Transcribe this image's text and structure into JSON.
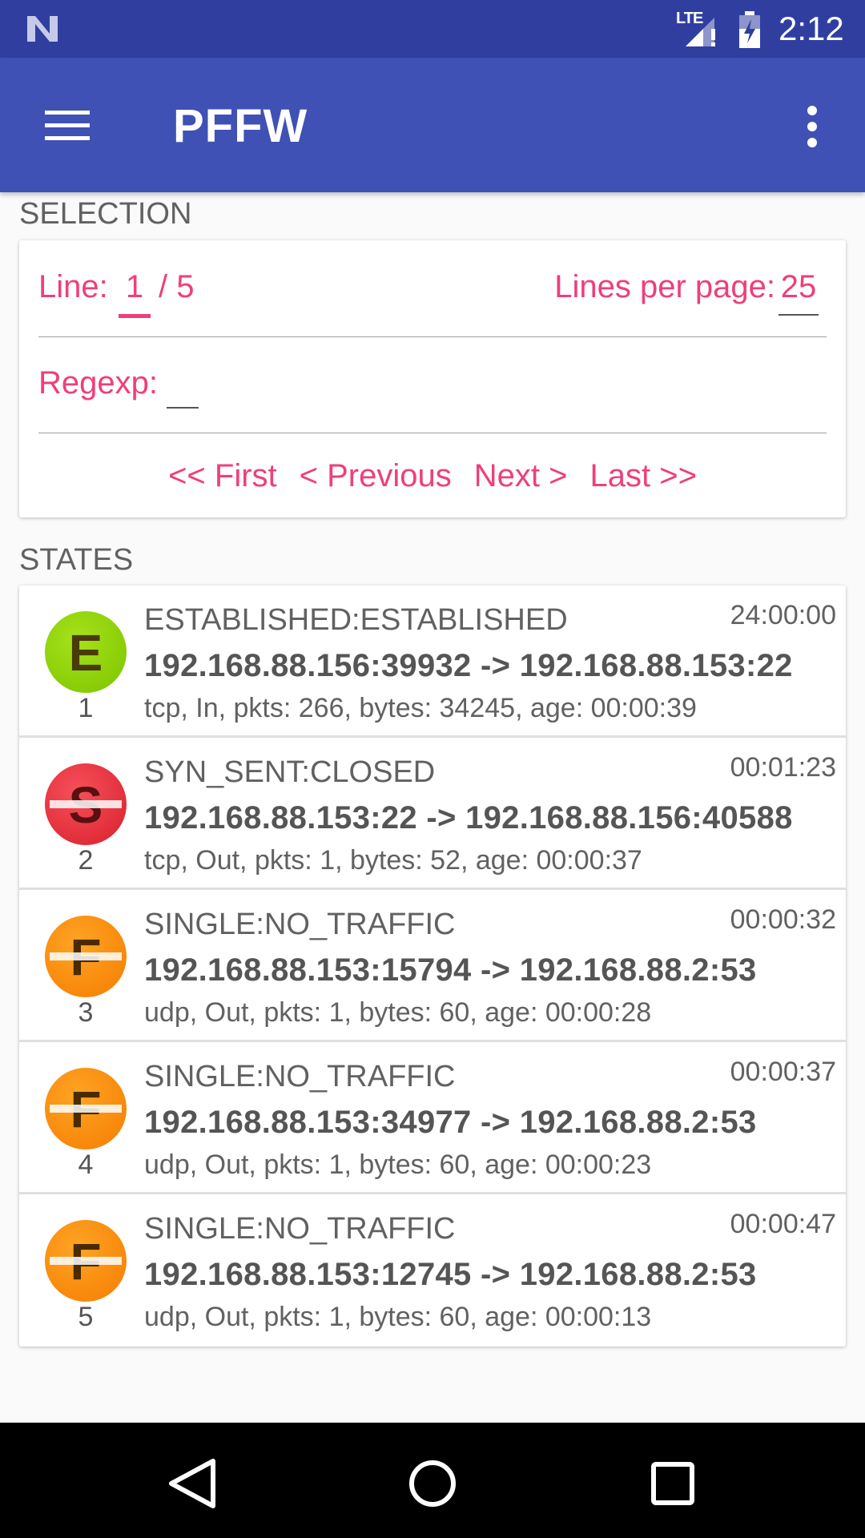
{
  "status_bar": {
    "network": "LTE",
    "time": "2:12",
    "icons": [
      "android-n-icon",
      "signal-icon",
      "battery-icon"
    ]
  },
  "app_bar": {
    "title": "PFFW",
    "menu_icon": "menu-icon",
    "overflow_icon": "more-vert-icon"
  },
  "selection": {
    "header": "SELECTION",
    "line_label": "Line:",
    "line_value": "1",
    "line_total": "/ 5",
    "lines_per_page_label": "Lines per page:",
    "lines_per_page_value": "25",
    "regexp_label": "Regexp:",
    "regexp_value": "",
    "pager": {
      "first": "<< First",
      "previous": "< Previous",
      "next": "Next >",
      "last": "Last >>"
    }
  },
  "states": {
    "header": "STATES",
    "rows": [
      {
        "num": "1",
        "letter": "E",
        "state": "ESTABLISHED:ESTABLISHED",
        "time": "24:00:00",
        "conn": "192.168.88.156:39932 -> 192.168.88.153:22",
        "detail": "tcp, In, pkts: 266, bytes: 34245, age: 00:00:39"
      },
      {
        "num": "2",
        "letter": "S",
        "state": "SYN_SENT:CLOSED",
        "time": "00:01:23",
        "conn": "192.168.88.153:22 -> 192.168.88.156:40588",
        "detail": "tcp, Out, pkts: 1, bytes: 52, age: 00:00:37"
      },
      {
        "num": "3",
        "letter": "F",
        "state": "SINGLE:NO_TRAFFIC",
        "time": "00:00:32",
        "conn": "192.168.88.153:15794 -> 192.168.88.2:53",
        "detail": "udp, Out, pkts: 1, bytes: 60, age: 00:00:28"
      },
      {
        "num": "4",
        "letter": "F",
        "state": "SINGLE:NO_TRAFFIC",
        "time": "00:00:37",
        "conn": "192.168.88.153:34977 -> 192.168.88.2:53",
        "detail": "udp, Out, pkts: 1, bytes: 60, age: 00:00:23"
      },
      {
        "num": "5",
        "letter": "F",
        "state": "SINGLE:NO_TRAFFIC",
        "time": "00:00:47",
        "conn": "192.168.88.153:12745 -> 192.168.88.2:53",
        "detail": "udp, Out, pkts: 1, bytes: 60, age: 00:00:13"
      }
    ]
  },
  "nav_bar": {
    "icons": [
      "back-icon",
      "home-icon",
      "recents-icon"
    ]
  },
  "colors": {
    "status_bar": "#303f9f",
    "app_bar": "#3f51b5",
    "accent": "#ef3f7b",
    "established_green": "#8fd400",
    "syn_red": "#e8303c",
    "single_orange": "#ff8a00"
  }
}
